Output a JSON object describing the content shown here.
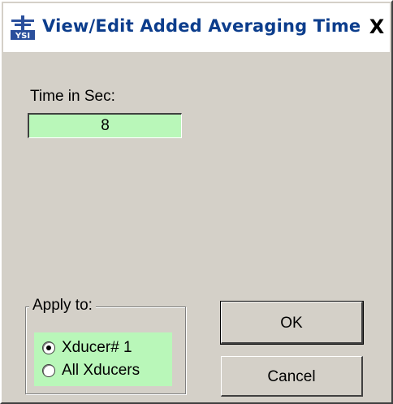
{
  "window": {
    "title": "View/Edit Added Averaging Time",
    "app_icon": "ysi-logo-icon",
    "app_icon_text": "YSI",
    "close_label": "X"
  },
  "time": {
    "label": "Time in Sec:",
    "value": "8"
  },
  "apply_to": {
    "label": "Apply to:",
    "options": [
      {
        "label": "Xducer# 1",
        "selected": true
      },
      {
        "label": "All Xducers",
        "selected": false
      }
    ]
  },
  "buttons": {
    "ok": "OK",
    "cancel": "Cancel"
  },
  "colors": {
    "field_background": "#b9f7b9",
    "title_text": "#0c3d8c",
    "dialog_face": "#d4d0c8"
  }
}
